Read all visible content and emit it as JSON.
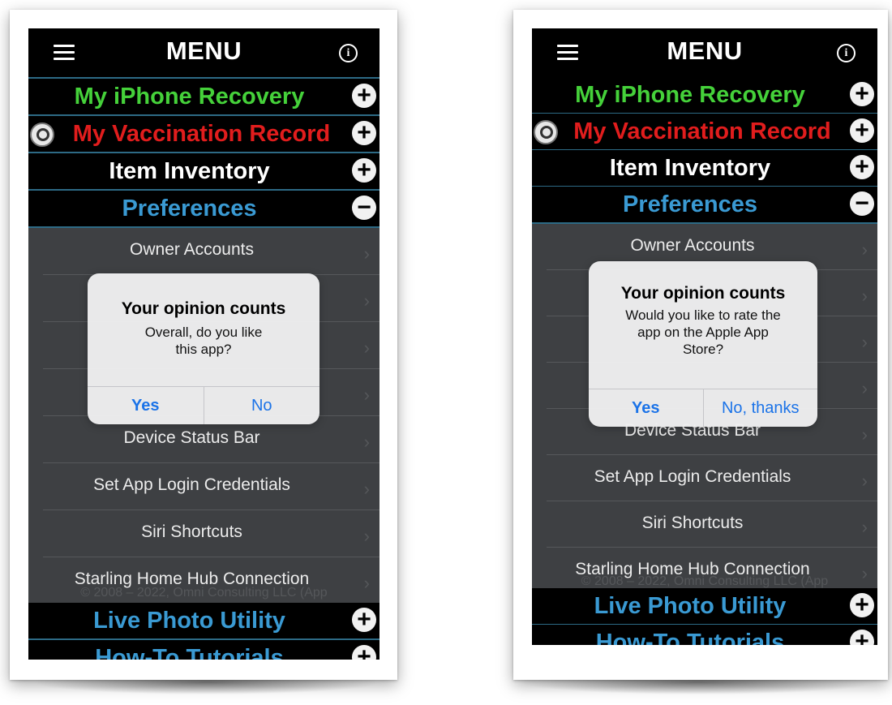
{
  "screens": [
    {
      "menu_title": "MENU",
      "sections_top": [
        {
          "label": "My iPhone Recovery",
          "color": "#45d13a",
          "icon": "plus-icon"
        },
        {
          "label": "My Vaccination Record",
          "color": "#e11d1d",
          "icon": "plus-icon",
          "has_zoom": true
        },
        {
          "label": "Item Inventory",
          "color": "#ffffff",
          "icon": "plus-icon"
        },
        {
          "label": "Preferences",
          "color": "#3a9ad3",
          "icon": "minus-icon"
        }
      ],
      "sub_items": [
        "Owner Accounts",
        "",
        "",
        "",
        "Device Status Bar",
        "Set App Login Credentials",
        "Siri Shortcuts",
        "Starling Home Hub Connection"
      ],
      "copyright": "© 2008 – 2022, Omni Consulting LLC (App",
      "sections_bottom": [
        {
          "label": "Live Photo Utility",
          "color": "#3a9ad3",
          "icon": "plus-icon"
        },
        {
          "label": "How-To Tutorials",
          "color": "#3a9ad3",
          "icon": "plus-icon"
        }
      ],
      "dialog": {
        "title": "Your opinion counts",
        "message_lines": [
          "Overall, do you like",
          "this app?"
        ],
        "buttons": [
          "Yes",
          "No"
        ]
      }
    },
    {
      "menu_title": "MENU",
      "sections_top": [
        {
          "label": "My iPhone Recovery",
          "color": "#45d13a",
          "icon": "plus-icon"
        },
        {
          "label": "My Vaccination Record",
          "color": "#e11d1d",
          "icon": "plus-icon",
          "has_zoom": true
        },
        {
          "label": "Item Inventory",
          "color": "#ffffff",
          "icon": "plus-icon"
        },
        {
          "label": "Preferences",
          "color": "#3a9ad3",
          "icon": "minus-icon"
        }
      ],
      "sub_items": [
        "Owner Accounts",
        "",
        "",
        "",
        "Device Status Bar",
        "Set App Login Credentials",
        "Siri Shortcuts",
        "Starling Home Hub Connection"
      ],
      "copyright": "© 2008 – 2022, Omni Consulting LLC (App",
      "sections_bottom": [
        {
          "label": "Live Photo Utility",
          "color": "#3a9ad3",
          "icon": "plus-icon"
        },
        {
          "label": "How-To Tutorials",
          "color": "#3a9ad3",
          "icon": "plus-icon"
        }
      ],
      "dialog": {
        "title": "Your opinion counts",
        "message_lines": [
          "Would you like to rate the",
          "app on the Apple App",
          "Store?"
        ],
        "buttons": [
          "Yes",
          "No, thanks"
        ]
      }
    }
  ]
}
